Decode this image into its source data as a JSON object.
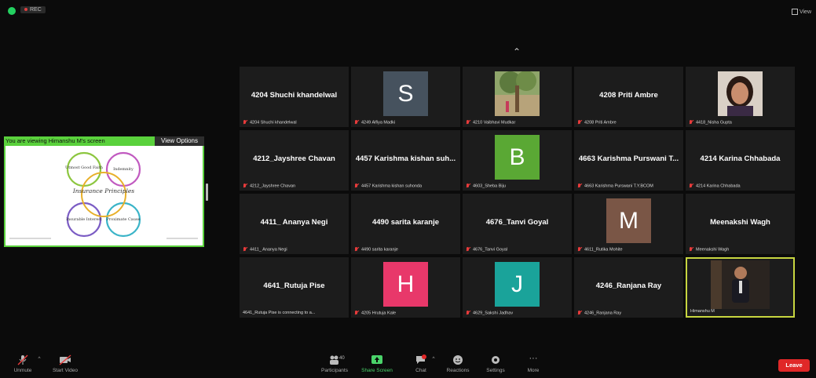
{
  "topbar": {
    "recording_label": "REC",
    "view_label": "View"
  },
  "share": {
    "banner": "You are viewing Himanshu M's screen",
    "view_options": "View Options",
    "slide": {
      "title": "Insurance Principles",
      "circles": [
        "Utmost Good Faith",
        "Indemnity",
        "Insurable Interest",
        "Proximate Cause"
      ]
    }
  },
  "tiles": [
    {
      "name": "4204 Shuchi khandelwal",
      "caption": "4204 Shuchi khandelwal",
      "kind": "name",
      "muted": true
    },
    {
      "name": "",
      "caption": "4249 Alfiya Madki",
      "kind": "letter",
      "letter": "S",
      "color": "#46525e",
      "muted": true
    },
    {
      "name": "",
      "caption": "4210 Vaibhavi Mudkar",
      "kind": "photo-tree",
      "muted": true
    },
    {
      "name": "4208 Priti Ambre",
      "caption": "4208 Priti Ambre",
      "kind": "name",
      "muted": true
    },
    {
      "name": "",
      "caption": "4418_Nisha Gupta",
      "kind": "photo-girl",
      "muted": true
    },
    {
      "name": "4212_Jayshree Chavan",
      "caption": "4212_Jayshree Chavan",
      "kind": "name",
      "muted": true
    },
    {
      "name": "4457 Karishma kishan suh...",
      "caption": "4457 Karishma kishan suhonda",
      "kind": "name",
      "muted": true
    },
    {
      "name": "",
      "caption": "4603_Sheba Biju",
      "kind": "letter",
      "letter": "B",
      "color": "#5aa834",
      "muted": true
    },
    {
      "name": "4663 Karishma Purswani T...",
      "caption": "4663 Karishma Purswani T.Y.BCOM",
      "kind": "name",
      "muted": true
    },
    {
      "name": "4214 Karina Chhabada",
      "caption": "4214 Karina Chhabada",
      "kind": "name",
      "muted": true
    },
    {
      "name": "4411_ Ananya Negi",
      "caption": "4411_ Ananya Negi",
      "kind": "name",
      "muted": true
    },
    {
      "name": "4490 sarita karanje",
      "caption": "4490 sarita karanje",
      "kind": "name",
      "muted": true
    },
    {
      "name": "4676_Tanvi Goyal",
      "caption": "4676_Tanvi Goyal",
      "kind": "name",
      "muted": true
    },
    {
      "name": "",
      "caption": "4611_Rutika Mohite",
      "kind": "letter",
      "letter": "M",
      "color": "#7a5646",
      "muted": true
    },
    {
      "name": "Meenakshi Wagh",
      "caption": "Meenakshi Wagh",
      "kind": "name",
      "muted": true
    },
    {
      "name": "4641_Rutuja Pise",
      "caption": "4641_Rutuja Pise is connecting to a...",
      "kind": "name",
      "muted": false
    },
    {
      "name": "",
      "caption": "4205 Hrutuja Kale",
      "kind": "letter",
      "letter": "H",
      "color": "#e8386a",
      "muted": true
    },
    {
      "name": "",
      "caption": "4629_Sakshi Jadhav",
      "kind": "letter",
      "letter": "J",
      "color": "#1aa39a",
      "muted": true
    },
    {
      "name": "4246_Ranjana Ray",
      "caption": "4246_Ranjana Ray",
      "kind": "name",
      "muted": true
    },
    {
      "name": "",
      "caption": "Himanshu M",
      "kind": "photo-man",
      "muted": false,
      "active": true
    }
  ],
  "toolbar": {
    "unmute": "Unmute",
    "start_video": "Start Video",
    "participants": "Participants",
    "participants_count": "40",
    "share_screen": "Share Screen",
    "chat": "Chat",
    "reactions": "Reactions",
    "settings": "Settings",
    "more": "More",
    "leave": "Leave"
  }
}
